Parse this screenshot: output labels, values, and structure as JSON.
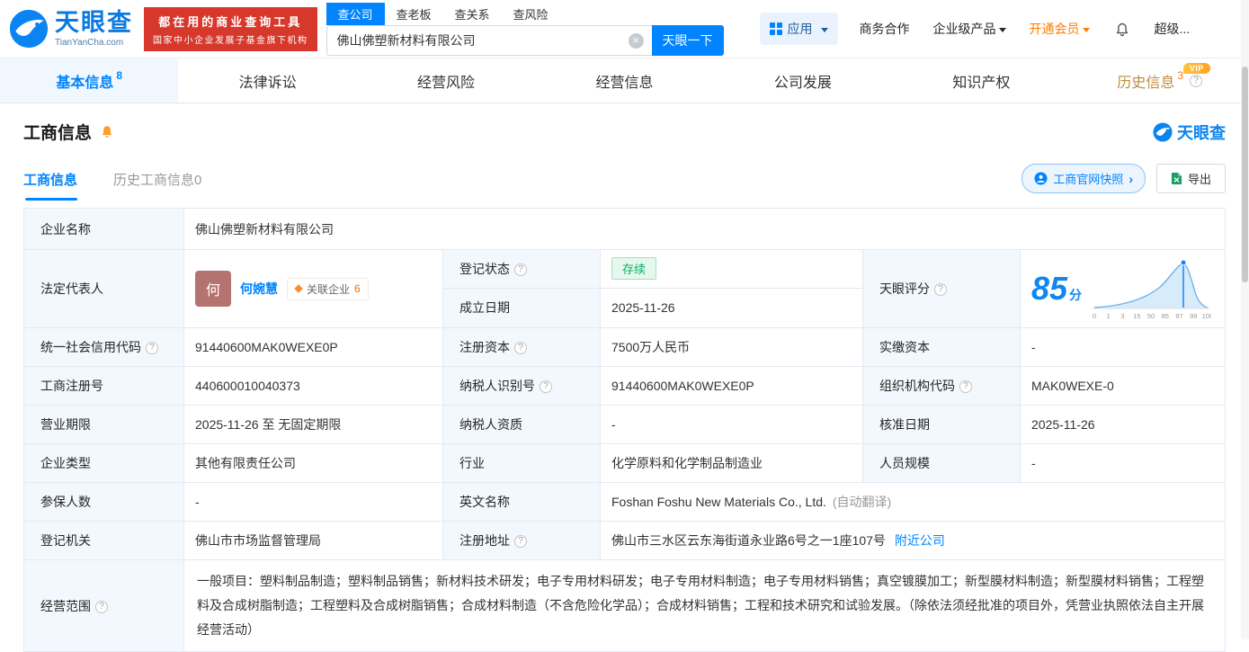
{
  "brand": {
    "name": "天眼查",
    "domain": "TianYanCha.com",
    "promo_line1": "都在用的商业查询工具",
    "promo_line2": "国家中小企业发展子基金旗下机构"
  },
  "search": {
    "tabs": [
      {
        "label": "查公司",
        "active": true
      },
      {
        "label": "查老板",
        "active": false
      },
      {
        "label": "查关系",
        "active": false
      },
      {
        "label": "查风险",
        "active": false
      }
    ],
    "value": "佛山佛塑新材料有限公司",
    "submit_label": "天眼一下"
  },
  "top_nav": {
    "apps_label": "应用",
    "business_coop": "商务合作",
    "enterprise_products": "企业级产品",
    "open_membership": "开通会员",
    "super": "超级..."
  },
  "main_tabs": [
    {
      "label": "基本信息",
      "count": "8"
    },
    {
      "label": "法律诉讼"
    },
    {
      "label": "经营风险"
    },
    {
      "label": "经营信息"
    },
    {
      "label": "公司发展"
    },
    {
      "label": "知识产权"
    },
    {
      "label": "历史信息",
      "count": "3"
    }
  ],
  "badges": {
    "vip": "VIP"
  },
  "section": {
    "title": "工商信息",
    "logo_text": "天眼查",
    "sub_tabs": [
      {
        "label": "工商信息",
        "active": true
      },
      {
        "label": "历史工商信息0",
        "active": false
      }
    ],
    "snapshot_button": "工商官网快照",
    "export_button": "导出"
  },
  "fields": {
    "company_name": {
      "label": "企业名称",
      "value": "佛山佛塑新材料有限公司"
    },
    "legal_rep": {
      "label": "法定代表人",
      "avatar_char": "何",
      "name": "何婉慧",
      "related_label": "关联企业",
      "related_count": "6"
    },
    "reg_status": {
      "label": "登记状态",
      "value": "存续"
    },
    "establish_date": {
      "label": "成立日期",
      "value": "2025-11-26"
    },
    "score": {
      "label": "天眼评分"
    },
    "credit_code": {
      "label": "统一社会信用代码",
      "value": "91440600MAK0WEXE0P"
    },
    "reg_capital": {
      "label": "注册资本",
      "value": "7500万人民币"
    },
    "paid_capital": {
      "label": "实缴资本",
      "value": "-"
    },
    "reg_number": {
      "label": "工商注册号",
      "value": "440600010040373"
    },
    "taxpayer_id": {
      "label": "纳税人识别号",
      "value": "91440600MAK0WEXE0P"
    },
    "org_code": {
      "label": "组织机构代码",
      "value": "MAK0WEXE-0"
    },
    "business_term": {
      "label": "营业期限",
      "value": "2025-11-26 至 无固定期限"
    },
    "taxpayer_quals": {
      "label": "纳税人资质",
      "value": "-"
    },
    "approval_date": {
      "label": "核准日期",
      "value": "2025-11-26"
    },
    "company_type": {
      "label": "企业类型",
      "value": "其他有限责任公司"
    },
    "industry": {
      "label": "行业",
      "value": "化学原料和化学制品制造业"
    },
    "staff_size": {
      "label": "人员规模",
      "value": "-"
    },
    "insured_num": {
      "label": "参保人数",
      "value": "-"
    },
    "english_name": {
      "label": "英文名称",
      "value": "Foshan Foshu New Materials Co., Ltd.",
      "note": "(自动翻译)"
    },
    "reg_authority": {
      "label": "登记机关",
      "value": "佛山市市场监督管理局"
    },
    "reg_address": {
      "label": "注册地址",
      "value": "佛山市三水区云东海街道永业路6号之一1座107号",
      "link": "附近公司"
    },
    "business_scope": {
      "label": "经营范围",
      "value": "一般项目：塑料制品制造；塑料制品销售；新材料技术研发；电子专用材料研发；电子专用材料制造；电子专用材料销售；真空镀膜加工；新型膜材料制造；新型膜材料销售；工程塑料及合成树脂制造；工程塑料及合成树脂销售；合成材料制造（不含危险化学品）；合成材料销售；工程和技术研究和试验发展。（除依法须经批准的项目外，凭营业执照依法自主开展经营活动）"
    }
  },
  "score_chart": {
    "score": "85",
    "unit": "分",
    "ticks": [
      "0",
      "1",
      "3",
      "15",
      "50",
      "85",
      "97",
      "99",
      "100"
    ]
  },
  "icons": {
    "help": "?",
    "caret_down": "▾",
    "chevron_right": "›",
    "clear": "×"
  },
  "colors": {
    "brand_blue": "#0084ff",
    "promo_red": "#d7382c",
    "membership_orange": "#ff7d00",
    "history_gold": "#bd8c3e",
    "status_green": "#00b365",
    "label_cell_bg": "#f2f8fd",
    "avatar_bg": "#b4736e"
  }
}
